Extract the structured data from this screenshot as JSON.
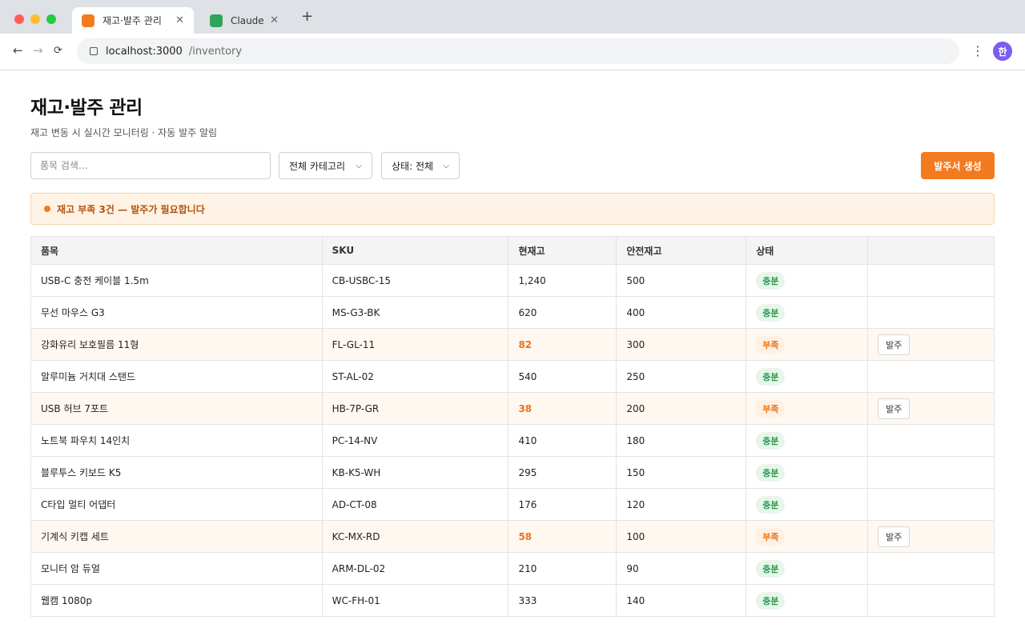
{
  "browser": {
    "tabs": [
      {
        "title": "재고·발주 관리",
        "favicon_color": "#f47a1f"
      },
      {
        "title": "Claude",
        "favicon_color": "#2ea55a"
      }
    ],
    "url_host": "localhost:3000",
    "url_path": "/inventory",
    "profile_initial": "한"
  },
  "header": {
    "title": "재고·발주 관리",
    "subtitle": "재고 변동 시 실시간 모니터링 · 자동 발주 알림"
  },
  "controls": {
    "search_placeholder": "품목 검색...",
    "category_select": "전체 카테고리",
    "status_select": "상태: 전체",
    "create_po_label": "발주서 생성"
  },
  "alert": {
    "text": "재고 부족 3건 — 발주가 필요합니다"
  },
  "table": {
    "columns": [
      "품목",
      "SKU",
      "현재고",
      "안전재고",
      "상태",
      ""
    ],
    "order_label": "발주",
    "rows": [
      {
        "name": "USB-C 충전 케이블 1.5m",
        "sku": "CB-USBC-15",
        "stock": "1,240",
        "safety": "500",
        "status": "충분",
        "low": false
      },
      {
        "name": "무선 마우스 G3",
        "sku": "MS-G3-BK",
        "stock": "620",
        "safety": "400",
        "status": "충분",
        "low": false
      },
      {
        "name": "강화유리 보호필름 11형",
        "sku": "FL-GL-11",
        "stock": "82",
        "safety": "300",
        "status": "부족",
        "low": true
      },
      {
        "name": "알루미늄 거치대 스탠드",
        "sku": "ST-AL-02",
        "stock": "540",
        "safety": "250",
        "status": "충분",
        "low": false
      },
      {
        "name": "USB 허브 7포트",
        "sku": "HB-7P-GR",
        "stock": "38",
        "safety": "200",
        "status": "부족",
        "low": true
      },
      {
        "name": "노트북 파우치 14인치",
        "sku": "PC-14-NV",
        "stock": "410",
        "safety": "180",
        "status": "충분",
        "low": false
      },
      {
        "name": "블루투스 키보드 K5",
        "sku": "KB-K5-WH",
        "stock": "295",
        "safety": "150",
        "status": "충분",
        "low": false
      },
      {
        "name": "C타입 멀티 어댑터",
        "sku": "AD-CT-08",
        "stock": "176",
        "safety": "120",
        "status": "충분",
        "low": false
      },
      {
        "name": "기계식 키캡 세트",
        "sku": "KC-MX-RD",
        "stock": "58",
        "safety": "100",
        "status": "부족",
        "low": true
      },
      {
        "name": "모니터 암 듀얼",
        "sku": "ARM-DL-02",
        "stock": "210",
        "safety": "90",
        "status": "충분",
        "low": false
      },
      {
        "name": "웹캠 1080p",
        "sku": "WC-FH-01",
        "stock": "333",
        "safety": "140",
        "status": "충분",
        "low": false
      }
    ]
  }
}
